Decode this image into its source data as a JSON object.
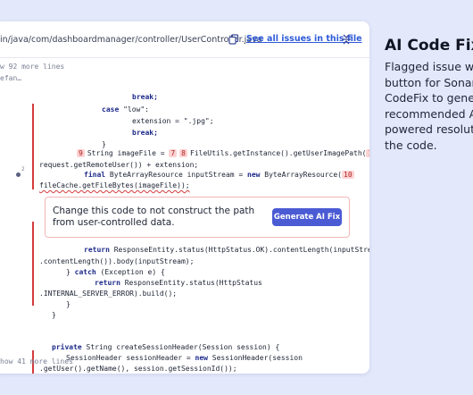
{
  "header": {
    "file_path": "in/java/com/dashboardmanager/controller/UserController.java",
    "see_all_label": "See all issues in this file"
  },
  "expanders": {
    "top": "w 92 more lines",
    "bottom": "how 41 more lines"
  },
  "left_label": "efan…",
  "line_marker": "2",
  "code": {
    "l1": "break;",
    "l2a": "case ",
    "l2b": "\"low\":",
    "l3": "extension = \".jpg\";",
    "l4": "break;",
    "l5": "}",
    "l6_marker": "9",
    "l6_text": "String imageFile = ",
    "l6_m2": "7",
    "l6_m3": "8",
    "l6_call": "FileUtils.getInstance().getUserImagePath(",
    "l6_m4": "1",
    "l7": "request.getRemoteUser()) + extension;",
    "l8a": "final ",
    "l8b": "ByteArrayResource inputStream = ",
    "l8c": "new ",
    "l8d": "ByteArrayResource(",
    "l8_m": "10",
    "l9": "fileCache.getFileBytes(imageFile));",
    "l10a": "return ",
    "l10b": "ResponseEntity.status(HttpStatus.OK).contentLength(inputStrea",
    "l11": ".contentLength()).body(inputStream);",
    "l12a": "} ",
    "l12b": "catch ",
    "l12c": "(Exception e) {",
    "l13a": "return ",
    "l13b": "ResponseEntity.status(HttpStatus",
    "l14": ".INTERNAL_SERVER_ERROR).build();",
    "l15": "}",
    "l16": "}",
    "l17a": "private ",
    "l17b": "String createSessionHeader(Session session) {",
    "l18a": "SessionHeader sessionHeader = ",
    "l18b": "new ",
    "l18c": "SessionHeader(session",
    "l19": ".getUser().getName(), session.getSessionId());"
  },
  "issue": {
    "message": "Change this code to not construct the path from user-controlled data.",
    "fix_button": "Generate AI Fix"
  },
  "side_panel": {
    "title": "AI Code Fix",
    "lines": [
      "Flagged issue wi",
      "button for Sonar",
      "CodeFix to gener",
      "recommended A",
      "powered resoluti",
      "the code."
    ]
  },
  "colors": {
    "background": "#e3e8fb",
    "accent": "#4a5bd4",
    "link": "#2f5bd9",
    "issue_red": "#d43b3b",
    "marker_bg": "#fcd3d3"
  },
  "icons": {
    "copy": "copy-icon",
    "collapse": "collapse-icon",
    "issue_dot": "dot-icon"
  }
}
